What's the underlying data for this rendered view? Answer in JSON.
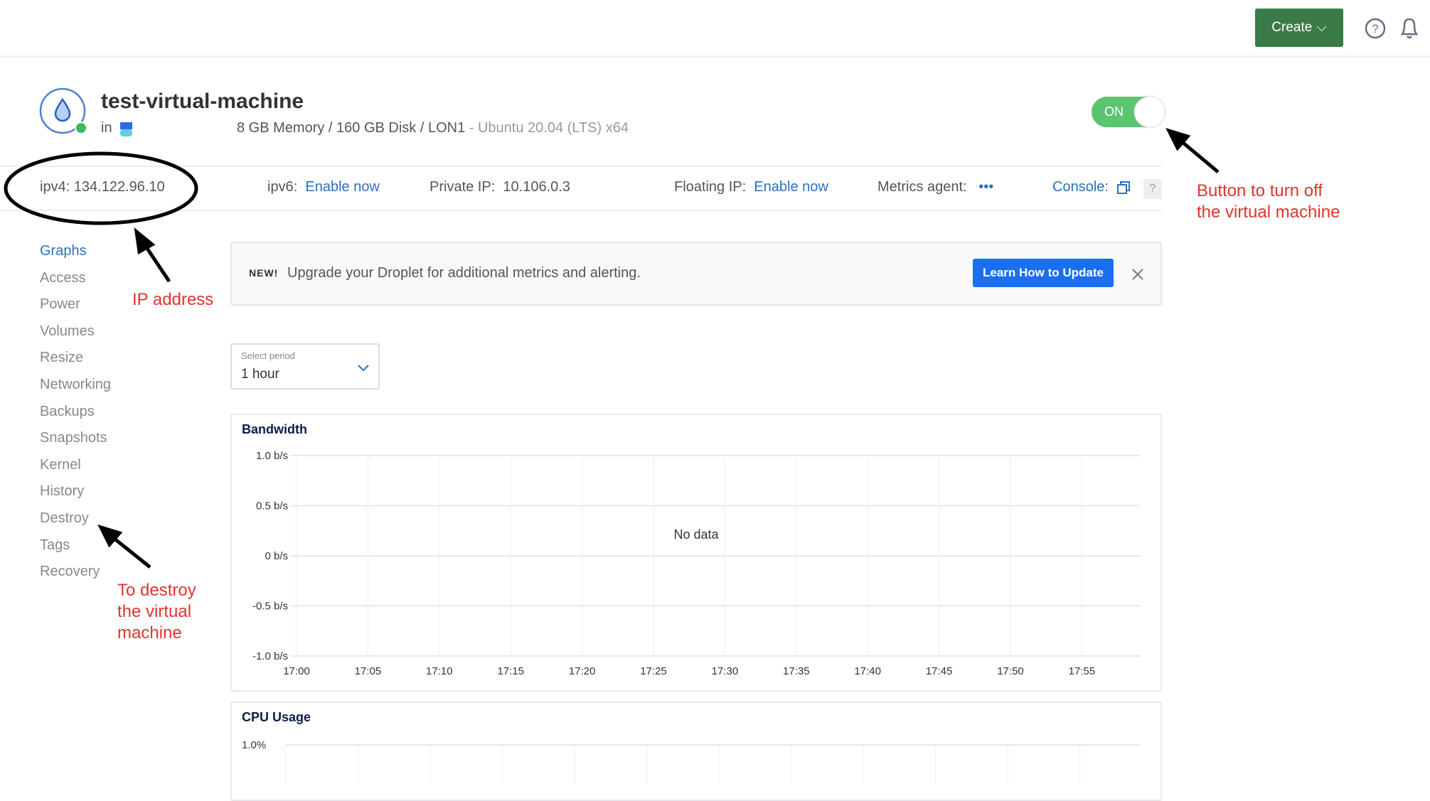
{
  "header": {
    "create_label": "Create",
    "help_icon": "help-circle-icon",
    "bell_icon": "bell-icon",
    "create_color": "#3a7b48"
  },
  "droplet": {
    "name": "test-virtual-machine",
    "in_label": "in",
    "specs": "8 GB Memory / 160 GB Disk / LON1",
    "os": " - Ubuntu 20.04 (LTS) x64",
    "power_toggle": "ON",
    "power_color": "#5cc36f",
    "status_color": "#3dbb5a"
  },
  "info": {
    "ipv4_label": "ipv4:",
    "ipv4": "134.122.96.10",
    "ipv6_label": "ipv6:",
    "ipv6_link": "Enable now",
    "private_label": "Private IP:",
    "private_ip": "10.106.0.3",
    "floating_label": "Floating IP:",
    "floating_link": "Enable now",
    "metrics_label": "Metrics agent:",
    "metrics_value": "•••",
    "console_label": "Console:",
    "help": "?"
  },
  "sidebar": {
    "items": [
      {
        "label": "Graphs",
        "active": true
      },
      {
        "label": "Access"
      },
      {
        "label": "Power"
      },
      {
        "label": "Volumes"
      },
      {
        "label": "Resize"
      },
      {
        "label": "Networking"
      },
      {
        "label": "Backups"
      },
      {
        "label": "Snapshots"
      },
      {
        "label": "Kernel"
      },
      {
        "label": "History"
      },
      {
        "label": "Destroy"
      },
      {
        "label": "Tags"
      },
      {
        "label": "Recovery"
      }
    ]
  },
  "banner": {
    "badge": "NEW!",
    "text": "Upgrade your Droplet for additional metrics and alerting.",
    "button": "Learn How to Update"
  },
  "period": {
    "label": "Select period",
    "value": "1 hour"
  },
  "annotations": {
    "ip": "IP address",
    "destroy": [
      "To destroy",
      "the virtual",
      "machine"
    ],
    "toggle": [
      "Button to turn off",
      "the virtual machine"
    ]
  },
  "chart_data": [
    {
      "type": "line",
      "title": "Bandwidth",
      "empty_text": "No data",
      "y_ticks": [
        "1.0 b/s",
        "0.5 b/s",
        "0 b/s",
        "-0.5 b/s",
        "-1.0 b/s"
      ],
      "ylim": [
        -1.0,
        1.0
      ],
      "x_ticks": [
        "17:00",
        "17:05",
        "17:10",
        "17:15",
        "17:20",
        "17:25",
        "17:30",
        "17:35",
        "17:40",
        "17:45",
        "17:50",
        "17:55"
      ],
      "grid": true,
      "series": []
    },
    {
      "type": "line",
      "title": "CPU Usage",
      "y_ticks": [
        "1.0%"
      ],
      "grid": true,
      "series": []
    }
  ]
}
